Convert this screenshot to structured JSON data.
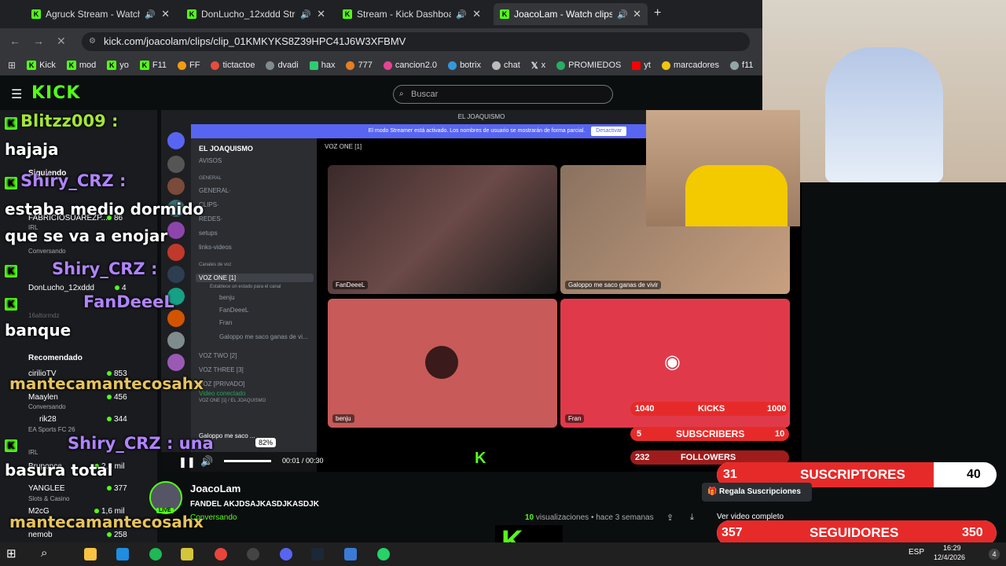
{
  "tabs": [
    {
      "label": "Agruck Stream - Watch Live"
    },
    {
      "label": "DonLucho_12xddd Stream"
    },
    {
      "label": "Stream - Kick Dashboard"
    },
    {
      "label": "JoacoLam - Watch clips on"
    }
  ],
  "url": "kick.com/joacolam/clips/clip_01KMKYKS8Z39HPC41J6W3XFBMV",
  "bookmarks": [
    "Kick",
    "mod",
    "yo",
    "F11",
    "FF",
    "tictactoe",
    "dvadi",
    "hax",
    "777",
    "cancion2.0",
    "botrix",
    "chat",
    "x",
    "PROMIEDOS",
    "yt",
    "marcadores",
    "f11"
  ],
  "kick": {
    "logo": "KICK",
    "search_placeholder": "Buscar"
  },
  "discord": {
    "top_title": "EL JOAQUISMO",
    "banner": "El modo Streamer está activado. Los nombres de usuario se mostrarán de forma parcial.",
    "banner_button": "Desactivar",
    "server_name": "EL JOAQUISMO",
    "voice_header": "VOZ ONE [1]",
    "channels": [
      "AVISOS",
      "GENERAL",
      "GENERAL·",
      "CLIPS·",
      "REDES·",
      "setups",
      "links-videos",
      "Canales de voz",
      "VOZ ONE [1]",
      "Establece un estado para el canal",
      "benju",
      "FanDeeeL",
      "Fran",
      "Galoppo me saco ganas de vi...",
      "VOZ TWO [2]",
      "VOZ THREE [3]",
      "VOZ [PRIVADO]"
    ],
    "video_status": "Video conectado",
    "video_sub": "VOZ ONE [1] / EL JOAQUISMO",
    "self_user": "Galoppo me saco ...",
    "tiles": [
      "FanDeeeL",
      "Galoppo me saco ganas de vivir",
      "benju",
      "Fran"
    ]
  },
  "player": {
    "volume_pct": "82%",
    "time": "00:01 / 00:30",
    "progress": 0.03
  },
  "chat_overlay": [
    {
      "name": "Blitzz009 :",
      "msg": "hajaja"
    },
    {
      "name": "Shiry_CRZ :",
      "msg": "estaba medio dormido"
    },
    {
      "name": "",
      "msg": "que se va a enojar"
    },
    {
      "name": "Shiry_CRZ :",
      "msg": ""
    },
    {
      "name": "FanDeeeL",
      "msg": "banque"
    },
    {
      "name": "",
      "msg": "mantecamantecosahx"
    },
    {
      "name": "Shiry_CRZ : una",
      "msg": "basura total"
    },
    {
      "name": "",
      "msg": "mantecamantecosahx"
    }
  ],
  "sidebar": [
    {
      "label": "Siguiendo",
      "sub": "",
      "count": ""
    },
    {
      "label": "FABRICIOSUAREZP...",
      "sub": "IRL",
      "count": "86"
    },
    {
      "label": "",
      "sub": "Conversando",
      "count": ""
    },
    {
      "label": "DonLucho_12xddd",
      "sub": "",
      "count": "4"
    },
    {
      "label": "16altormdz",
      "sub": "",
      "count": ""
    },
    {
      "label": "Recomendado",
      "sub": "",
      "count": ""
    },
    {
      "label": "cirilioTV",
      "sub": "",
      "count": "853"
    },
    {
      "label": "Maaylen",
      "sub": "Conversando",
      "count": "456"
    },
    {
      "label": "rik28",
      "sub": "EA Sports FC 26",
      "count": "344"
    },
    {
      "label": "",
      "sub": "IRL",
      "count": ""
    },
    {
      "label": "Bruponce",
      "sub": "",
      "count": "2,8 mil"
    },
    {
      "label": "YANGLEE",
      "sub": "Slots & Casino",
      "count": "377"
    },
    {
      "label": "M2cG",
      "sub": "",
      "count": "1,6 mil"
    },
    {
      "label": "nemob",
      "sub": "",
      "count": "258"
    }
  ],
  "counters": {
    "kicks": {
      "label": "KICKS",
      "current": "1040",
      "goal": "1000"
    },
    "subs": {
      "label": "SUBSCRIBERS",
      "current": "5",
      "goal": "10"
    },
    "follows": {
      "label": "FOLLOWERS",
      "current": "232",
      "goal": ""
    },
    "suscriptores": {
      "label": "SUSCRIPTORES",
      "current": "31",
      "goal": "40",
      "fill": 0.775
    },
    "seguidores": {
      "label": "SEGUIDORES",
      "current": "357",
      "goal": "350",
      "fill": 1.0
    }
  },
  "channel": {
    "name": "JoacoLam",
    "clip_title": "FANDEL AKJDSAJKASDJKASDJK",
    "category": "Conversando",
    "live_badge": "LIVE",
    "views_count": "10",
    "views_label": "visualizaciones",
    "age": "hace 3 semanas",
    "gift_button": "Regala Suscripciones",
    "full_video": "Ver video completo"
  },
  "taskbar": {
    "lang": "ESP",
    "time": "16:29",
    "date": "12/4/2026",
    "badge": "4"
  },
  "colors": {
    "kick_green": "#53fc18",
    "discord_blurple": "#5865f2",
    "alert_red": "#e62a2a"
  }
}
